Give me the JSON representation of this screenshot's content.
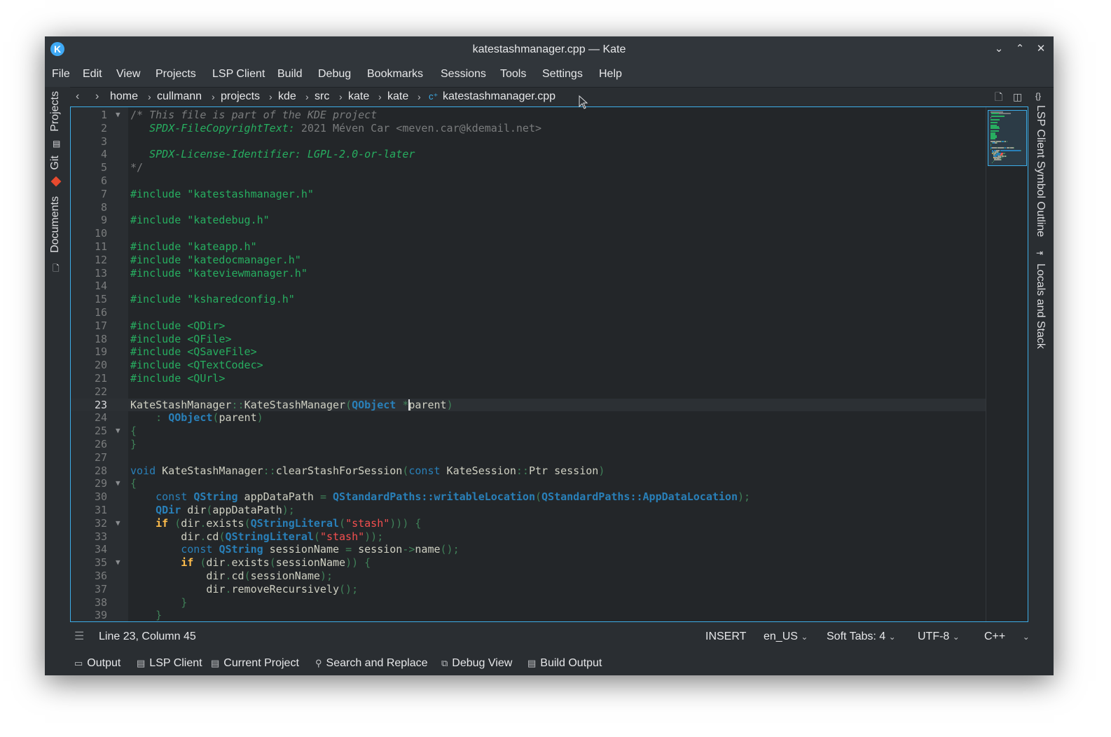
{
  "window": {
    "title": "katestashmanager.cpp — Kate"
  },
  "menu": [
    "File",
    "Edit",
    "View",
    "Projects",
    "LSP Client",
    "Build",
    "Debug",
    "Bookmarks",
    "Sessions",
    "Tools",
    "Settings",
    "Help"
  ],
  "left_tabs": {
    "projects": "Projects",
    "git": "Git",
    "documents": "Documents"
  },
  "right_tabs": {
    "symbols": "LSP Client Symbol Outline",
    "locals": "Locals and Stack"
  },
  "breadcrumb": [
    "home",
    "cullmann",
    "projects",
    "kde",
    "src",
    "kate",
    "kate",
    "katestashmanager.cpp"
  ],
  "editor": {
    "current_line": 23,
    "lines": [
      {
        "n": "1",
        "fold": "▼",
        "segs": [
          [
            "c-cmt2",
            "/* "
          ],
          [
            "c-cmt",
            "This file is part of the KDE project"
          ]
        ]
      },
      {
        "n": "2",
        "fold": "",
        "segs": [
          [
            "c-spdx",
            "   SPDX-FileCopyrightText: "
          ],
          [
            "c-cmt2",
            "2021 Méven Car <meven.car@kdemail.net>"
          ]
        ]
      },
      {
        "n": "3",
        "fold": "",
        "segs": []
      },
      {
        "n": "4",
        "fold": "",
        "segs": [
          [
            "c-spdx",
            "   SPDX-License-Identifier: LGPL-2.0-or-later"
          ]
        ]
      },
      {
        "n": "5",
        "fold": "",
        "segs": [
          [
            "c-cmt2",
            "*/"
          ]
        ]
      },
      {
        "n": "6",
        "fold": "",
        "segs": []
      },
      {
        "n": "7",
        "fold": "",
        "segs": [
          [
            "c-pre",
            "#include \"katestashmanager.h\""
          ]
        ]
      },
      {
        "n": "8",
        "fold": "",
        "segs": []
      },
      {
        "n": "9",
        "fold": "",
        "segs": [
          [
            "c-pre",
            "#include \"katedebug.h\""
          ]
        ]
      },
      {
        "n": "10",
        "fold": "",
        "segs": []
      },
      {
        "n": "11",
        "fold": "",
        "segs": [
          [
            "c-pre",
            "#include \"kateapp.h\""
          ]
        ]
      },
      {
        "n": "12",
        "fold": "",
        "segs": [
          [
            "c-pre",
            "#include \"katedocmanager.h\""
          ]
        ]
      },
      {
        "n": "13",
        "fold": "",
        "segs": [
          [
            "c-pre",
            "#include \"kateviewmanager.h\""
          ]
        ]
      },
      {
        "n": "14",
        "fold": "",
        "segs": []
      },
      {
        "n": "15",
        "fold": "",
        "segs": [
          [
            "c-pre",
            "#include \"ksharedconfig.h\""
          ]
        ]
      },
      {
        "n": "16",
        "fold": "",
        "segs": []
      },
      {
        "n": "17",
        "fold": "",
        "segs": [
          [
            "c-pre",
            "#include <QDir>"
          ]
        ]
      },
      {
        "n": "18",
        "fold": "",
        "segs": [
          [
            "c-pre",
            "#include <QFile>"
          ]
        ]
      },
      {
        "n": "19",
        "fold": "",
        "segs": [
          [
            "c-pre",
            "#include <QSaveFile>"
          ]
        ]
      },
      {
        "n": "20",
        "fold": "",
        "segs": [
          [
            "c-pre",
            "#include <QTextCodec>"
          ]
        ]
      },
      {
        "n": "21",
        "fold": "",
        "segs": [
          [
            "c-pre",
            "#include <QUrl>"
          ]
        ]
      },
      {
        "n": "22",
        "fold": "",
        "segs": []
      },
      {
        "n": "23",
        "fold": "",
        "segs": [
          [
            "c-plain",
            "KateStashManager"
          ],
          [
            "c-op",
            "::"
          ],
          [
            "c-plain",
            "KateStashManager"
          ],
          [
            "c-op",
            "("
          ],
          [
            "c-type",
            "QObject"
          ],
          [
            "c-plain",
            " "
          ],
          [
            "c-op",
            "*"
          ],
          [
            "cursor",
            ""
          ],
          [
            "c-plain",
            "parent"
          ],
          [
            "c-op",
            ")"
          ]
        ]
      },
      {
        "n": "24",
        "fold": "",
        "segs": [
          [
            "c-plain",
            "    "
          ],
          [
            "c-op",
            ":"
          ],
          [
            "c-plain",
            " "
          ],
          [
            "c-type",
            "QObject"
          ],
          [
            "c-op",
            "("
          ],
          [
            "c-plain",
            "parent"
          ],
          [
            "c-op",
            ")"
          ]
        ]
      },
      {
        "n": "25",
        "fold": "▼",
        "segs": [
          [
            "c-op",
            "{"
          ]
        ]
      },
      {
        "n": "26",
        "fold": "",
        "segs": [
          [
            "c-op",
            "}"
          ]
        ]
      },
      {
        "n": "27",
        "fold": "",
        "segs": []
      },
      {
        "n": "28",
        "fold": "",
        "segs": [
          [
            "c-kw2",
            "void"
          ],
          [
            "c-plain",
            " KateStashManager"
          ],
          [
            "c-op",
            "::"
          ],
          [
            "c-plain",
            "clearStashForSession"
          ],
          [
            "c-op",
            "("
          ],
          [
            "c-kw2",
            "const"
          ],
          [
            "c-plain",
            " KateSession"
          ],
          [
            "c-op",
            "::"
          ],
          [
            "c-plain",
            "Ptr session"
          ],
          [
            "c-op",
            ")"
          ]
        ]
      },
      {
        "n": "29",
        "fold": "▼",
        "segs": [
          [
            "c-op",
            "{"
          ]
        ]
      },
      {
        "n": "30",
        "fold": "",
        "segs": [
          [
            "c-plain",
            "    "
          ],
          [
            "c-kw2",
            "const"
          ],
          [
            "c-plain",
            " "
          ],
          [
            "c-type",
            "QString"
          ],
          [
            "c-plain",
            " appDataPath "
          ],
          [
            "c-op",
            "="
          ],
          [
            "c-plain",
            " "
          ],
          [
            "c-type",
            "QStandardPaths::writableLocation"
          ],
          [
            "c-op",
            "("
          ],
          [
            "c-type",
            "QStandardPaths::AppDataLocation"
          ],
          [
            "c-op",
            ");"
          ]
        ]
      },
      {
        "n": "31",
        "fold": "",
        "segs": [
          [
            "c-plain",
            "    "
          ],
          [
            "c-type",
            "QDir"
          ],
          [
            "c-plain",
            " dir"
          ],
          [
            "c-op",
            "("
          ],
          [
            "c-plain",
            "appDataPath"
          ],
          [
            "c-op",
            ");"
          ]
        ]
      },
      {
        "n": "32",
        "fold": "▼",
        "segs": [
          [
            "c-plain",
            "    "
          ],
          [
            "c-kw",
            "if"
          ],
          [
            "c-plain",
            " "
          ],
          [
            "c-op",
            "("
          ],
          [
            "c-plain",
            "dir"
          ],
          [
            "c-op",
            "."
          ],
          [
            "c-plain",
            "exists"
          ],
          [
            "c-op",
            "("
          ],
          [
            "c-type",
            "QStringLiteral"
          ],
          [
            "c-op",
            "("
          ],
          [
            "c-str",
            "\"stash\""
          ],
          [
            "c-op",
            ")))"
          ],
          [
            "c-plain",
            " "
          ],
          [
            "c-op",
            "{"
          ]
        ]
      },
      {
        "n": "33",
        "fold": "",
        "segs": [
          [
            "c-plain",
            "        dir"
          ],
          [
            "c-op",
            "."
          ],
          [
            "c-plain",
            "cd"
          ],
          [
            "c-op",
            "("
          ],
          [
            "c-type",
            "QStringLiteral"
          ],
          [
            "c-op",
            "("
          ],
          [
            "c-str",
            "\"stash\""
          ],
          [
            "c-op",
            "));"
          ]
        ]
      },
      {
        "n": "34",
        "fold": "",
        "segs": [
          [
            "c-plain",
            "        "
          ],
          [
            "c-kw2",
            "const"
          ],
          [
            "c-plain",
            " "
          ],
          [
            "c-type",
            "QString"
          ],
          [
            "c-plain",
            " sessionName "
          ],
          [
            "c-op",
            "="
          ],
          [
            "c-plain",
            " session"
          ],
          [
            "c-op",
            "->"
          ],
          [
            "c-plain",
            "name"
          ],
          [
            "c-op",
            "();"
          ]
        ]
      },
      {
        "n": "35",
        "fold": "▼",
        "segs": [
          [
            "c-plain",
            "        "
          ],
          [
            "c-kw",
            "if"
          ],
          [
            "c-plain",
            " "
          ],
          [
            "c-op",
            "("
          ],
          [
            "c-plain",
            "dir"
          ],
          [
            "c-op",
            "."
          ],
          [
            "c-plain",
            "exists"
          ],
          [
            "c-op",
            "("
          ],
          [
            "c-plain",
            "sessionName"
          ],
          [
            "c-op",
            "))"
          ],
          [
            "c-plain",
            " "
          ],
          [
            "c-op",
            "{"
          ]
        ]
      },
      {
        "n": "36",
        "fold": "",
        "segs": [
          [
            "c-plain",
            "            dir"
          ],
          [
            "c-op",
            "."
          ],
          [
            "c-plain",
            "cd"
          ],
          [
            "c-op",
            "("
          ],
          [
            "c-plain",
            "sessionName"
          ],
          [
            "c-op",
            ");"
          ]
        ]
      },
      {
        "n": "37",
        "fold": "",
        "segs": [
          [
            "c-plain",
            "            dir"
          ],
          [
            "c-op",
            "."
          ],
          [
            "c-plain",
            "removeRecursively"
          ],
          [
            "c-op",
            "();"
          ]
        ]
      },
      {
        "n": "38",
        "fold": "",
        "segs": [
          [
            "c-plain",
            "        "
          ],
          [
            "c-op",
            "}"
          ]
        ]
      },
      {
        "n": "39",
        "fold": "",
        "segs": [
          [
            "c-plain",
            "    "
          ],
          [
            "c-op",
            "}"
          ]
        ]
      }
    ]
  },
  "status": {
    "position": "Line 23, Column 45",
    "mode": "INSERT",
    "dictionary": "en_US",
    "indent": "Soft Tabs: 4",
    "encoding": "UTF-8",
    "syntax": "C++"
  },
  "bottom_tools": [
    "Output",
    "LSP Client",
    "Current Project",
    "Search and Replace",
    "Debug View",
    "Build Output"
  ],
  "colors": {
    "accent": "#3daee9",
    "background": "#232629",
    "chrome": "#31363b"
  }
}
